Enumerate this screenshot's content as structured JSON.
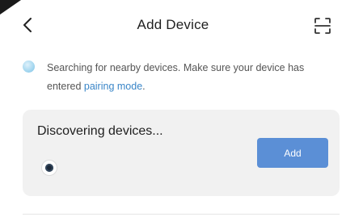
{
  "header": {
    "title": "Add Device",
    "back_icon": "chevron-left-icon",
    "scan_icon": "scan-icon"
  },
  "notice": {
    "icon": "searching-icon",
    "text_before_link": "Searching for nearby devices. Make sure your device has entered ",
    "link_text": "pairing mode",
    "text_after_link": "."
  },
  "discovery": {
    "heading": "Discovering devices...",
    "device_icon": "camera-device-icon",
    "add_label": "Add"
  },
  "colors": {
    "accent": "#5b8fd6",
    "link": "#3a86c8",
    "card_background": "#f1f1f1"
  }
}
